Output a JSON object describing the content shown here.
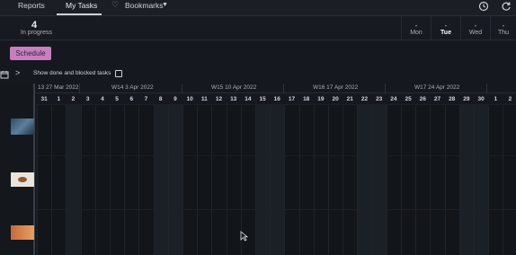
{
  "topnav": {
    "tabs": [
      {
        "label": "Reports"
      },
      {
        "label": "My Tasks",
        "active": true
      },
      {
        "label": "Bookmarks"
      }
    ]
  },
  "summary": {
    "count": "4",
    "label": "In progress"
  },
  "days": [
    {
      "dash": "-",
      "label": "Mon",
      "active": false
    },
    {
      "dash": "-",
      "label": "Tue",
      "active": true
    },
    {
      "dash": "-",
      "label": "Wed",
      "active": false
    },
    {
      "dash": "-",
      "label": "Thu",
      "active": false
    }
  ],
  "schedule_button": "Schedule",
  "toolbar": {
    "show_label": "Show done and blocked tasks",
    "checked": false
  },
  "weeks": [
    {
      "label": "13 27 Mar 2022"
    },
    {
      "label": "W14 3 Apr 2022"
    },
    {
      "label": "W15 10 Apr 2022"
    },
    {
      "label": "W16 17 Apr 2022"
    },
    {
      "label": "W17 24 Apr 2022"
    }
  ],
  "dates": [
    "31",
    "1",
    "2",
    "3",
    "4",
    "5",
    "6",
    "7",
    "8",
    "9",
    "10",
    "11",
    "12",
    "13",
    "14",
    "15",
    "16",
    "17",
    "18",
    "19",
    "20",
    "21",
    "22",
    "23",
    "24",
    "25",
    "26",
    "27",
    "28",
    "29",
    "30",
    "1",
    "2"
  ],
  "weekend_indices": [
    2,
    8,
    9,
    15,
    16,
    22,
    23,
    29,
    30
  ],
  "colors": {
    "accent": "#c77fc0",
    "background": "#15191f"
  }
}
